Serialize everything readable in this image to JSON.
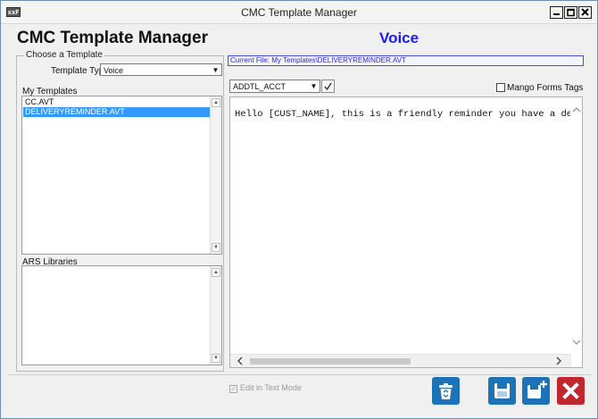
{
  "window": {
    "title": "CMC Template Manager",
    "icon_text": "xxF",
    "controls": [
      "minimize",
      "maximize",
      "close"
    ]
  },
  "header": {
    "title": "CMC Template Manager",
    "mode": "Voice"
  },
  "choose_template": {
    "legend": "Choose a Template",
    "template_type_label": "Template Type",
    "template_type_value": "Voice"
  },
  "my_templates": {
    "label": "My Templates",
    "items": [
      "CC.AVT",
      "DELIVERYREMINDER.AVT"
    ],
    "selected_index": 1
  },
  "ars_libraries": {
    "label": "ARS Libraries",
    "items": []
  },
  "editor": {
    "current_file": "Current File: My Templates\\DELIVERYREMINDER.AVT",
    "field_select_value": "ADDTL_ACCT",
    "mango_forms_label": "Mango Forms Tags",
    "mango_forms_checked": false,
    "text": "Hello [CUST_NAME], this is a friendly reminder you have a delivery to"
  },
  "footer": {
    "edit_text_mode_label": "Edit in Text Mode",
    "edit_text_mode_checked": true
  },
  "colors": {
    "accent_blue": "#1a1aff",
    "selection": "#3399ff",
    "toolbar_button": "#1e72b8",
    "delete_button": "#c0282d"
  },
  "toolbar_icons": [
    "recycle-bin-icon",
    "save-icon",
    "save-new-icon",
    "close-x-icon"
  ]
}
